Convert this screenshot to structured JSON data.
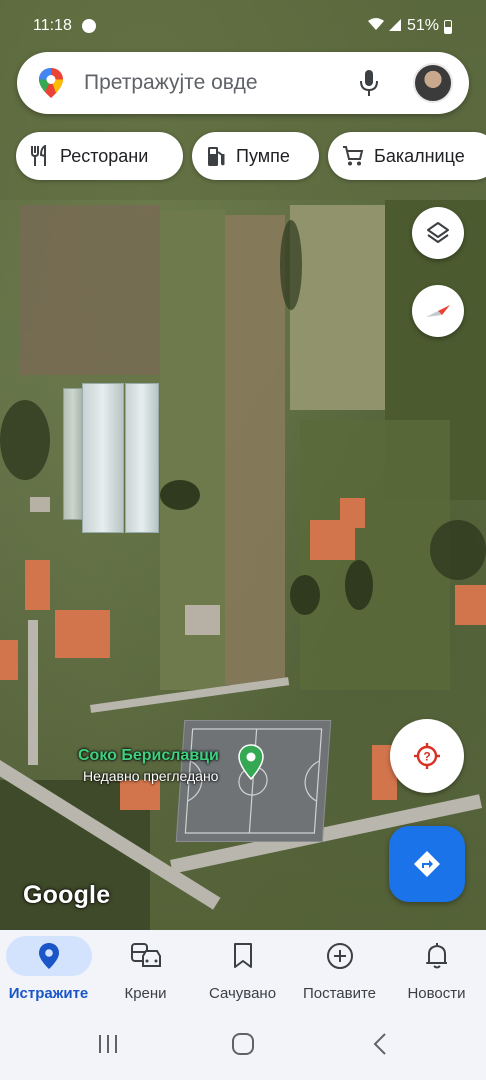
{
  "status_bar": {
    "time": "11:18",
    "battery": "51%",
    "app_icon": "facebook-icon",
    "wifi_icon": "wifi-icon",
    "signal_icon": "signal-icon",
    "battery_icon": "battery-icon"
  },
  "search": {
    "placeholder": "Претражујте овде",
    "logo_icon": "maps-pin-logo",
    "mic_icon": "microphone-icon",
    "avatar": "profile-avatar"
  },
  "chips": [
    {
      "label": "Ресторани",
      "icon": "fork-knife-icon"
    },
    {
      "label": "Пумпе",
      "icon": "gas-pump-icon"
    },
    {
      "label": "Бакалнице",
      "icon": "shopping-cart-icon"
    }
  ],
  "map": {
    "place_name": "Соко Бериславци",
    "place_subtitle": "Недавно прегледано",
    "attribution": "Google",
    "colors": {
      "place_label": "#3fd07f",
      "pin": "#34a853",
      "accent": "#1a73e8"
    }
  },
  "controls": {
    "layers_icon": "layers-icon",
    "compass_icon": "compass-icon",
    "locate_icon": "my-location-icon",
    "directions_icon": "directions-icon"
  },
  "bottom_nav": [
    {
      "label": "Истражите",
      "icon": "location-pin-icon",
      "active": true
    },
    {
      "label": "Крени",
      "icon": "commute-icon",
      "active": false
    },
    {
      "label": "Сачувано",
      "icon": "bookmark-icon",
      "active": false
    },
    {
      "label": "Поставите",
      "icon": "add-circle-icon",
      "active": false
    },
    {
      "label": "Новости",
      "icon": "bell-icon",
      "active": false
    }
  ],
  "system_nav": {
    "recents_icon": "recents-icon",
    "home_icon": "home-icon",
    "back_icon": "back-icon"
  }
}
